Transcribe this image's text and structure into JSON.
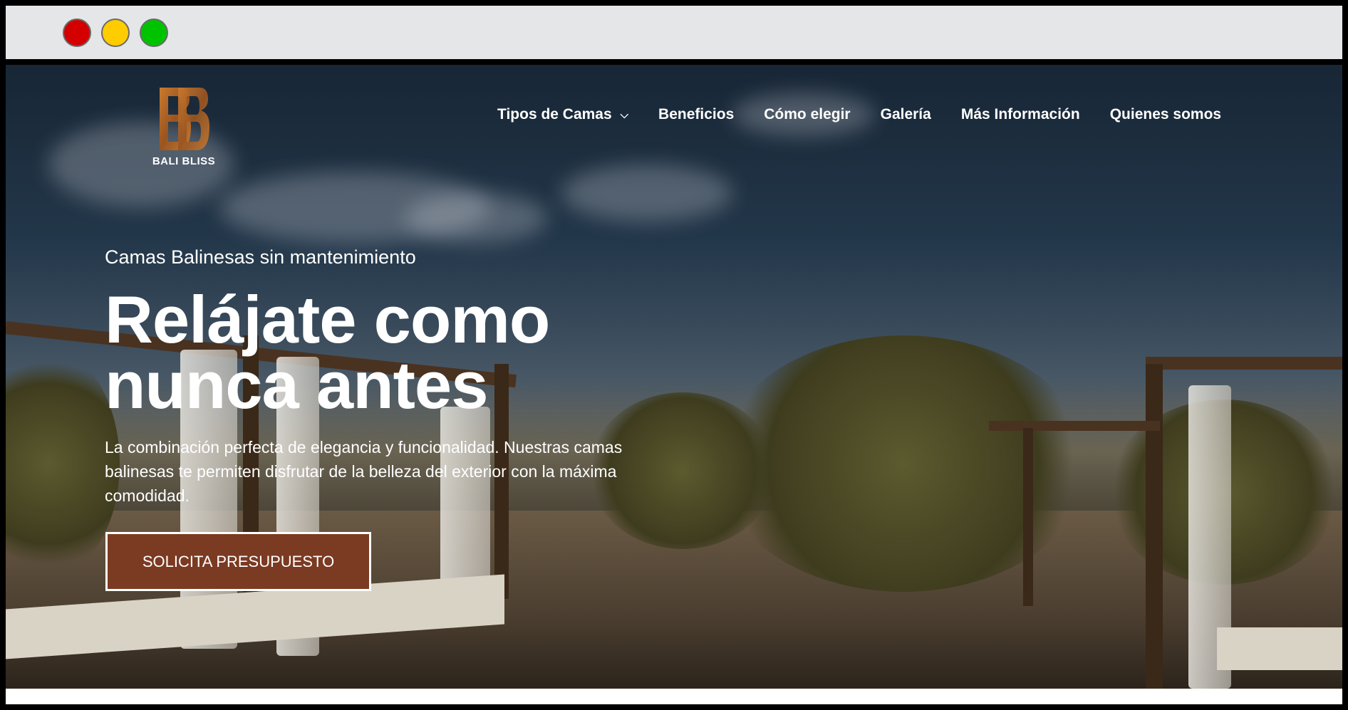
{
  "window": {
    "controls": [
      "close",
      "minimize",
      "maximize"
    ],
    "colors": {
      "close": "#d40000",
      "minimize": "#ffcc00",
      "maximize": "#00c300"
    }
  },
  "brand": {
    "name": "BALI BLISS",
    "logo_icon": "bb-wood-monogram-icon",
    "accent": "#b06a2c"
  },
  "nav": {
    "items": [
      {
        "label": "Tipos de Camas",
        "has_dropdown": true
      },
      {
        "label": "Beneficios"
      },
      {
        "label": "Cómo elegir"
      },
      {
        "label": "Galería"
      },
      {
        "label": "Más Información"
      },
      {
        "label": "Quienes somos"
      }
    ]
  },
  "hero": {
    "subtitle": "Camas Balinesas sin mantenimiento",
    "headline_line1": "Relájate como",
    "headline_line2": "nunca antes",
    "description": "La combinación perfecta de elegancia y funcionalidad. Nuestras camas balinesas te permiten disfrutar de la belleza del exterior con la máxima comodidad.",
    "cta_label": "SOLICITA PRESUPUESTO",
    "cta_color": "#7b3a22"
  }
}
